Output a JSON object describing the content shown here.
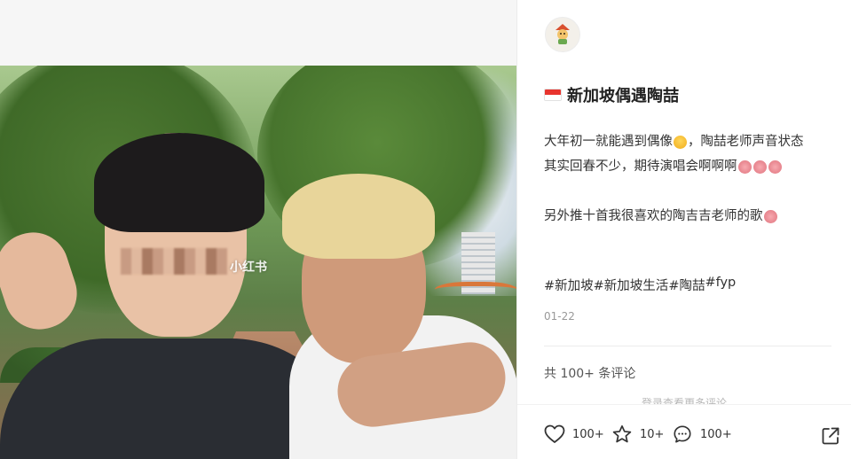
{
  "photo": {
    "watermark": "小红书"
  },
  "post": {
    "title": "新加坡偶遇陶喆",
    "body": {
      "line1_a": "大年初一就能遇到偶像",
      "line1_b": "，陶喆老师声音状态",
      "line2": "其实回春不少，期待演唱会啊啊啊",
      "line3": "另外推十首我很喜欢的陶吉吉老师的歌"
    },
    "tags": [
      "#新加坡",
      "#新加坡生活",
      "#陶喆",
      "#fyp"
    ],
    "date": "01-22"
  },
  "comments": {
    "summary": "共 100+ 条评论",
    "login_hint": "登录查看更多评论"
  },
  "actions": {
    "like_count": "100+",
    "collect_count": "10+",
    "comment_count": "100+"
  },
  "icons": {
    "like": "heart-icon",
    "collect": "star-icon",
    "comment": "chat-bubble-icon",
    "share": "share-icon",
    "flag": "singapore-flag-icon"
  },
  "colors": {
    "text": "#333333",
    "muted": "#999999",
    "flag_red": "#e8342e"
  }
}
